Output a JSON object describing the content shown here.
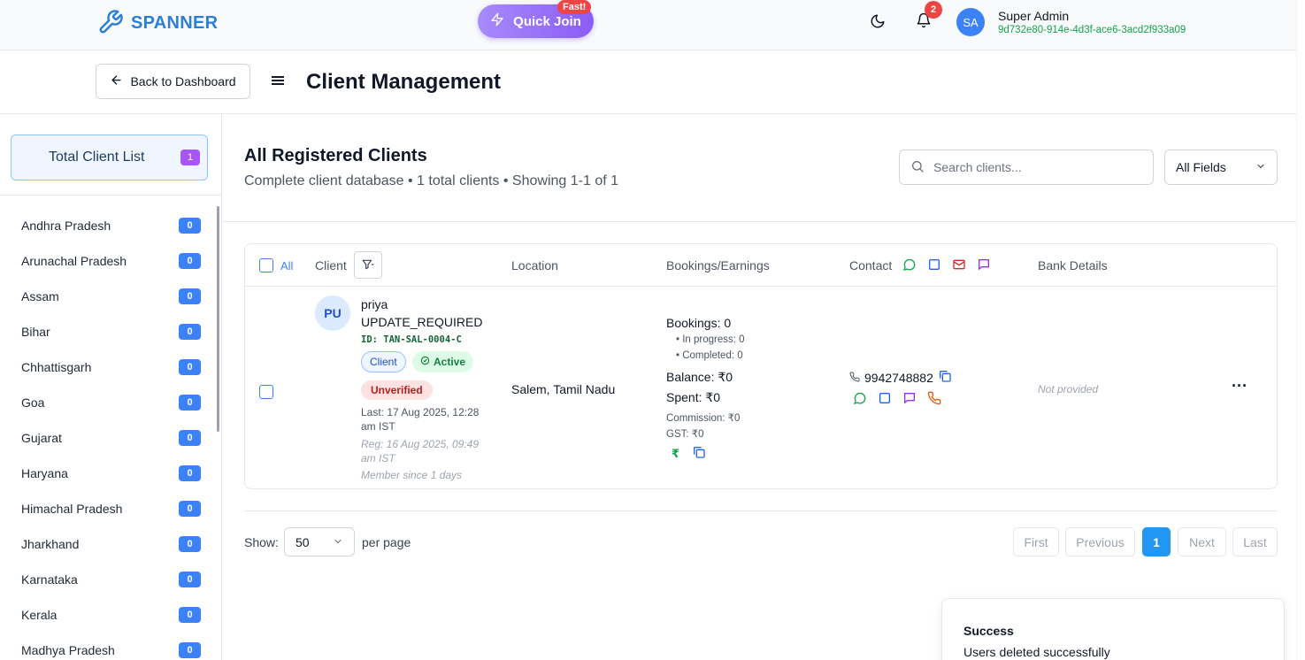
{
  "app": {
    "name": "SPANNER"
  },
  "topbar": {
    "quick_join": "Quick Join",
    "fast_badge": "Fast!",
    "notifications_count": "2",
    "avatar_initials": "SA",
    "user_name": "Super Admin",
    "user_id": "9d732e80-914e-4d3f-ace6-3acd2f933a09"
  },
  "header": {
    "back_label": "Back to Dashboard",
    "title": "Client Management"
  },
  "sidebar": {
    "total_label": "Total Client List",
    "total_count": "1",
    "states": [
      {
        "name": "Andhra Pradesh",
        "count": "0"
      },
      {
        "name": "Arunachal Pradesh",
        "count": "0"
      },
      {
        "name": "Assam",
        "count": "0"
      },
      {
        "name": "Bihar",
        "count": "0"
      },
      {
        "name": "Chhattisgarh",
        "count": "0"
      },
      {
        "name": "Goa",
        "count": "0"
      },
      {
        "name": "Gujarat",
        "count": "0"
      },
      {
        "name": "Haryana",
        "count": "0"
      },
      {
        "name": "Himachal Pradesh",
        "count": "0"
      },
      {
        "name": "Jharkhand",
        "count": "0"
      },
      {
        "name": "Karnataka",
        "count": "0"
      },
      {
        "name": "Kerala",
        "count": "0"
      },
      {
        "name": "Madhya Pradesh",
        "count": "0"
      }
    ]
  },
  "main": {
    "title": "All Registered Clients",
    "subtitle": "Complete client database • 1 total clients • Showing 1-1 of 1",
    "search_placeholder": "Search clients...",
    "field_select": "All Fields"
  },
  "table": {
    "headers": {
      "all": "All",
      "client": "Client",
      "location": "Location",
      "bookings": "Bookings/Earnings",
      "contact": "Contact",
      "bank": "Bank Details"
    },
    "row": {
      "initials": "PU",
      "name": "priya",
      "status": "UPDATE_REQUIRED",
      "id": "ID: TAN-SAL-0004-C",
      "tag_client": "Client",
      "tag_active": "Active",
      "tag_unverified": "Unverified",
      "last": "Last: 17 Aug 2025, 12:28 am IST",
      "reg": "Reg: 16 Aug 2025, 09:49 am IST",
      "member": "Member since 1 days",
      "location": "Salem, Tamil Nadu",
      "bookings": "Bookings: 0",
      "in_progress": "• In progress: 0",
      "completed": "• Completed: 0",
      "balance": "Balance: ₹0",
      "spent": "Spent: ₹0",
      "commission": "Commission: ₹0",
      "gst": "GST: ₹0",
      "rupee_symbol": "₹",
      "phone": "9942748882",
      "bank": "Not provided",
      "more": "···"
    }
  },
  "pager": {
    "show_label": "Show:",
    "per_page_value": "50",
    "per_page_label": "per page",
    "first": "First",
    "previous": "Previous",
    "current": "1",
    "next": "Next",
    "last": "Last"
  },
  "toast": {
    "title": "Success",
    "message": "Users deleted successfully"
  },
  "colors": {
    "brand": "#2b7fd6",
    "accent_purple": "#8b5cf6",
    "primary_blue": "#3b82f6",
    "success_green": "#16a34a",
    "danger_red": "#ef4444"
  }
}
